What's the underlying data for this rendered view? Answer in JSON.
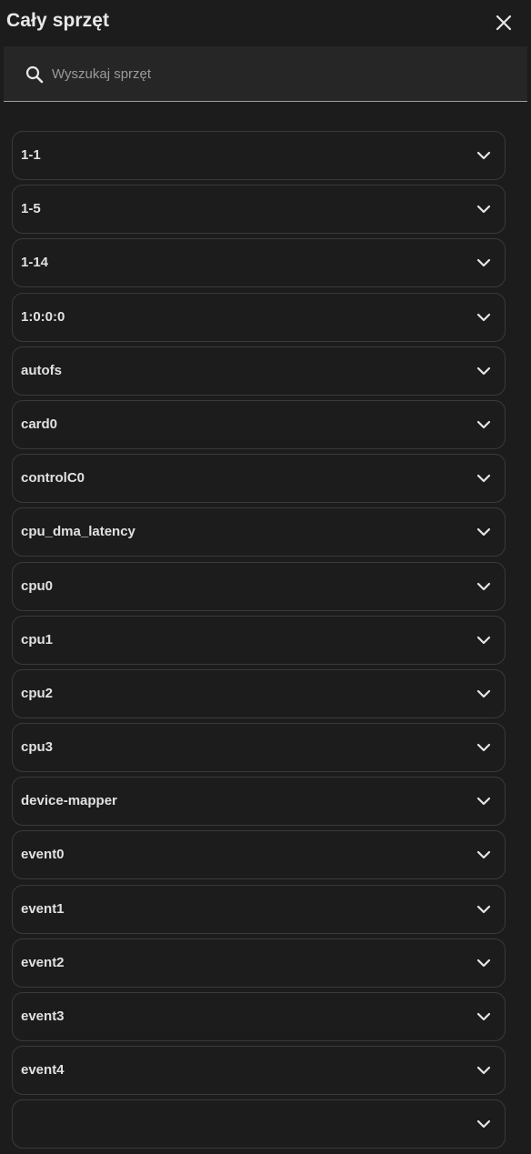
{
  "dialog": {
    "title": "Cały sprzęt"
  },
  "search": {
    "placeholder": "Wyszukaj sprzęt",
    "value": ""
  },
  "items": [
    {
      "label": "1-1"
    },
    {
      "label": "1-5"
    },
    {
      "label": "1-14"
    },
    {
      "label": "1:0:0:0"
    },
    {
      "label": "autofs"
    },
    {
      "label": "card0"
    },
    {
      "label": "controlC0"
    },
    {
      "label": "cpu_dma_latency"
    },
    {
      "label": "cpu0"
    },
    {
      "label": "cpu1"
    },
    {
      "label": "cpu2"
    },
    {
      "label": "cpu3"
    },
    {
      "label": "device-mapper"
    },
    {
      "label": "event0"
    },
    {
      "label": "event1"
    },
    {
      "label": "event2"
    },
    {
      "label": "event3"
    },
    {
      "label": "event4"
    },
    {
      "label": ""
    }
  ],
  "icons": {
    "close": "close-icon",
    "search": "search-icon",
    "expand": "chevron-down-icon"
  }
}
